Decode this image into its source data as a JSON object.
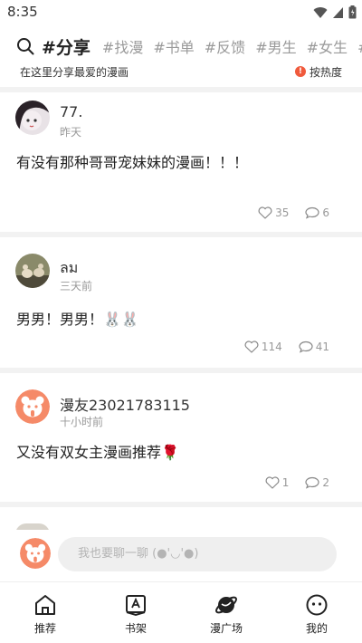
{
  "status": {
    "time": "8:35"
  },
  "topics": {
    "active": "#分享",
    "others": [
      "#找漫",
      "#书单",
      "#反馈",
      "#男生",
      "#女生",
      "#耽"
    ]
  },
  "subtitle": "在这里分享最爱的漫画",
  "sort_label": "按热度",
  "posts": [
    {
      "name": "77.",
      "time": "昨天",
      "content": "有没有那种哥哥宠妹妹的漫画！！！",
      "likes": "35",
      "comments": "6"
    },
    {
      "name": "ลม",
      "time": "三天前",
      "content": "男男！男男！🐰🐰",
      "likes": "114",
      "comments": "41"
    },
    {
      "name": "漫友23021783115",
      "time": "十小时前",
      "content": "又没有双女主漫画推荐🌹",
      "likes": "1",
      "comments": "2"
    }
  ],
  "composer": {
    "placeholder": "我也要聊一聊 (●'◡'●)"
  },
  "tabs": [
    {
      "label": "推荐",
      "icon": "home-icon"
    },
    {
      "label": "书架",
      "icon": "bookshelf-icon"
    },
    {
      "label": "漫广场",
      "icon": "planet-icon"
    },
    {
      "label": "我的",
      "icon": "profile-face-icon"
    }
  ],
  "colors": {
    "accent": "#f58a68",
    "badge": "#f05a3c"
  }
}
